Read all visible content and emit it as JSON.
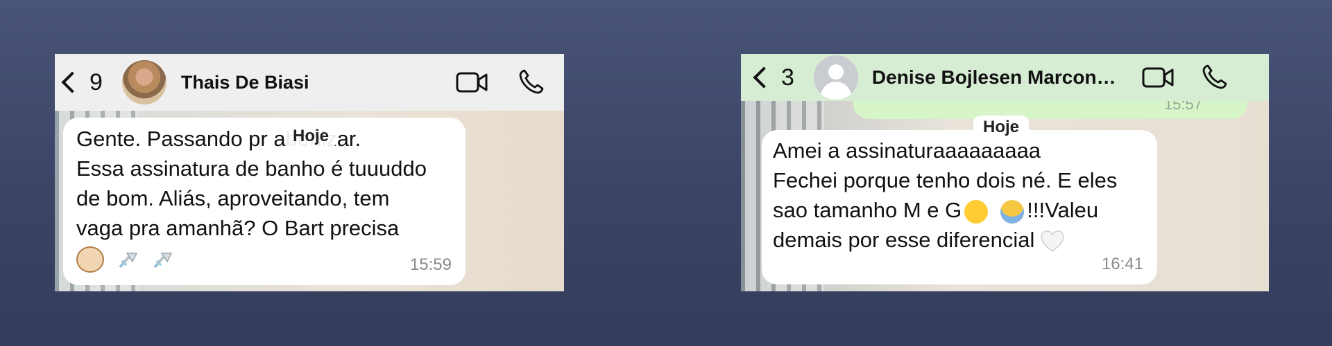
{
  "chat1": {
    "back_count": "9",
    "contact_name": "Thais  De Biasi",
    "day_label": "Hoje",
    "message_lines": [
      "Gente. Passando pr   abenizar.",
      "Essa assinatura de banho é tuuuddo",
      "de bom. Aliás, aproveitando, tem",
      "vaga pra amanhã? O Bart precisa"
    ],
    "message_emojis": [
      "dog-face",
      "shower",
      "shower"
    ],
    "time": "15:59"
  },
  "chat2": {
    "back_count": "3",
    "contact_name": "Denise Bojlesen Marcond...",
    "previous_time": "15:57",
    "day_label": "Hoje",
    "message_lines": [
      "Amei a assinaturaaaaaaaaa",
      "Fechei porque tenho dois né. E eles",
      "sao tamanho M e G",
      "demais por esse diferencial"
    ],
    "line3_suffix": "!!!Valeu",
    "message_emojis": [
      "face-with-tears-of-joy",
      "face-screaming",
      "white-heart"
    ],
    "time": "16:41"
  },
  "colors": {
    "background_top": "#4a5478",
    "header_group": "#d6edd3",
    "header_default": "#efefef",
    "outgoing_bubble": "#d6f5c8",
    "incoming_bubble": "#ffffff"
  }
}
